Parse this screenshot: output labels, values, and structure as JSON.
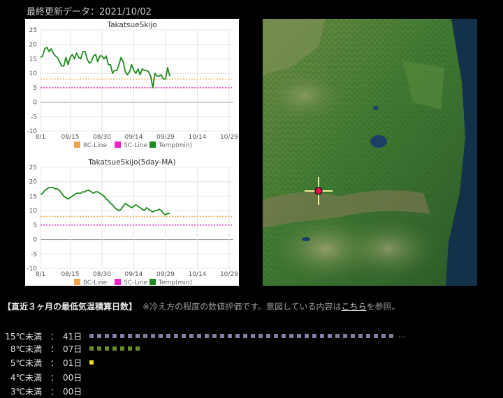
{
  "header": {
    "last_update": "最終更新データ：2021/10/02"
  },
  "chart_data": [
    {
      "type": "line",
      "title": "TakatsueSkijo",
      "x_ticks": [
        "8/1",
        "08/15",
        "08/30",
        "09/14",
        "09/29",
        "10/14",
        "10/29"
      ],
      "x_tick_days": [
        0,
        14,
        29,
        44,
        59,
        74,
        89
      ],
      "x_range_days": [
        0,
        91
      ],
      "y_ticks": [
        "25",
        "20",
        "15",
        "10",
        "5",
        "0",
        "-5",
        "-10"
      ],
      "ylim": [
        -10,
        25
      ],
      "reference_lines": [
        {
          "name": "8C-Line",
          "value": 8,
          "color": "#f2a540"
        },
        {
          "name": "5C-Line",
          "value": 5,
          "color": "#ee22c6"
        }
      ],
      "series": [
        {
          "name": "Temp(min)",
          "color": "#1e8a1e",
          "values": [
            15.5,
            16,
            18.5,
            19,
            17.5,
            18.5,
            17,
            16,
            15.5,
            14,
            12.5,
            12.5,
            15.5,
            13,
            15.5,
            16.5,
            15,
            17,
            15.5,
            15,
            17.5,
            17.5,
            15,
            13.5,
            14,
            16,
            16.5,
            14,
            16,
            16,
            15,
            16,
            13,
            13,
            10,
            11,
            11,
            13,
            15.5,
            14,
            10.5,
            9.5,
            10.5,
            13,
            11,
            10,
            11.5,
            9.5,
            11.5,
            11,
            11,
            10.5,
            9,
            5,
            10,
            9,
            9,
            9.5,
            8,
            8,
            12,
            9
          ]
        }
      ],
      "legend": [
        "8C-Line",
        "5C-Line",
        "Temp(min)"
      ],
      "legend_colors": [
        "#f2a540",
        "#ee22c6",
        "#1e8a1e"
      ]
    },
    {
      "type": "line",
      "title": "TakatsueSkijo(5day-MA)",
      "x_ticks": [
        "8/1",
        "08/15",
        "08/30",
        "09/14",
        "09/29",
        "10/14",
        "10/29"
      ],
      "x_tick_days": [
        0,
        14,
        29,
        44,
        59,
        74,
        89
      ],
      "x_range_days": [
        0,
        91
      ],
      "y_ticks": [
        "25",
        "20",
        "15",
        "10",
        "5",
        "0",
        "-5",
        "-10"
      ],
      "ylim": [
        -10,
        25
      ],
      "reference_lines": [
        {
          "name": "8C-Line",
          "value": 8,
          "color": "#f2a540"
        },
        {
          "name": "5C-Line",
          "value": 5,
          "color": "#ee22c6"
        }
      ],
      "series": [
        {
          "name": "Temp(min)",
          "color": "#1e8a1e",
          "values": [
            15.5,
            16,
            17,
            17.5,
            18,
            18,
            18,
            17.5,
            17.5,
            17,
            16,
            15,
            14.5,
            14,
            14.5,
            15,
            15.5,
            16,
            16,
            16,
            16.5,
            16.5,
            17,
            17,
            16.5,
            16,
            16.5,
            16.5,
            16,
            15.5,
            15,
            14,
            13.5,
            12.5,
            12,
            11,
            10.5,
            10,
            10.5,
            11.5,
            12.5,
            12,
            11.5,
            11,
            11.5,
            12,
            11.5,
            11,
            10.5,
            10,
            11,
            10.5,
            10,
            9.5,
            10,
            10,
            10.5,
            10,
            9,
            8.5,
            9,
            9
          ]
        }
      ],
      "legend": [
        "8C-Line",
        "5C-Line",
        "Temp(min)"
      ],
      "legend_colors": [
        "#f2a540",
        "#ee22c6",
        "#1e8a1e"
      ]
    }
  ],
  "summary": {
    "heading": "【直近３ヶ月の最低気温積算日数】",
    "note_before": "※冷え方の程度の数値評価です。意図している内容は",
    "note_link": "こちら",
    "note_after": "を参照。",
    "rows": [
      {
        "label": "15℃未満",
        "sep": "：",
        "value": "41日",
        "count": 41,
        "shown_dots": 40,
        "color": "#8a7aa0",
        "more": "…"
      },
      {
        "label": "8℃未満",
        "sep": "：",
        "value": "07日",
        "count": 7,
        "shown_dots": 7,
        "color": "#6b8a2c",
        "more": ""
      },
      {
        "label": "5℃未満",
        "sep": "：",
        "value": "01日",
        "count": 1,
        "shown_dots": 1,
        "color": "#f0e020",
        "more": ""
      },
      {
        "label": "4℃未満",
        "sep": "：",
        "value": "00日",
        "count": 0,
        "shown_dots": 0,
        "color": "#f0e020",
        "more": ""
      },
      {
        "label": "3℃未満",
        "sep": "：",
        "value": "00日",
        "count": 0,
        "shown_dots": 0,
        "color": "#f0e020",
        "more": ""
      }
    ]
  }
}
